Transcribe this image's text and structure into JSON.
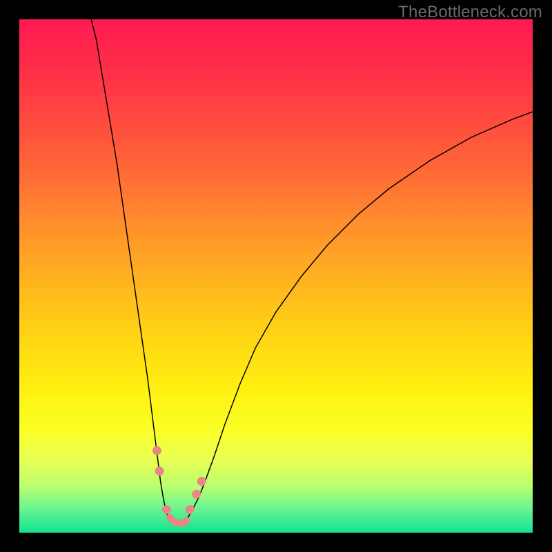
{
  "watermark": "TheBottleneck.com",
  "chart_data": {
    "type": "line",
    "title": "",
    "xlabel": "",
    "ylabel": "",
    "xlim": [
      0,
      100
    ],
    "ylim": [
      0,
      100
    ],
    "left_curve": {
      "x": [
        14,
        15,
        16,
        17,
        18,
        19,
        20,
        21,
        22,
        23,
        24,
        25,
        26,
        26.5,
        27,
        27.5,
        28,
        28.5,
        29,
        30
      ],
      "y": [
        100,
        96,
        90,
        84,
        78,
        72,
        65,
        58,
        51,
        44,
        37,
        30,
        22,
        18,
        14,
        10,
        7,
        4.5,
        3,
        2.2
      ]
    },
    "right_curve": {
      "x": [
        32,
        33,
        34,
        35,
        36,
        38,
        40,
        43,
        46,
        50,
        55,
        60,
        66,
        72,
        80,
        88,
        96,
        100
      ],
      "y": [
        2.2,
        3.2,
        5,
        7,
        9.5,
        15,
        21,
        29,
        36,
        43,
        50,
        56,
        62,
        67,
        72.5,
        77,
        80.5,
        82
      ]
    },
    "valley_segment": {
      "x": [
        30,
        30.5,
        31,
        31.5,
        32
      ],
      "y": [
        2.2,
        1.9,
        1.8,
        1.9,
        2.2
      ]
    },
    "marker_dots_left": [
      {
        "x": 26.8,
        "y": 16
      },
      {
        "x": 27.3,
        "y": 12
      },
      {
        "x": 28.7,
        "y": 4.5
      }
    ],
    "marker_dots_right": [
      {
        "x": 33.2,
        "y": 4.5
      },
      {
        "x": 34.5,
        "y": 7.5
      },
      {
        "x": 35.5,
        "y": 10
      }
    ],
    "valley_marker_path": [
      {
        "x": 29.3,
        "y": 3.0
      },
      {
        "x": 30.0,
        "y": 2.2
      },
      {
        "x": 30.7,
        "y": 1.9
      },
      {
        "x": 31.4,
        "y": 1.8
      },
      {
        "x": 32.0,
        "y": 1.9
      },
      {
        "x": 32.6,
        "y": 2.4
      }
    ],
    "background_gradient": {
      "top": "#ff1a52",
      "bottom": "#0fe391",
      "note": "vertical red→orange→yellow→green heat gradient"
    }
  }
}
